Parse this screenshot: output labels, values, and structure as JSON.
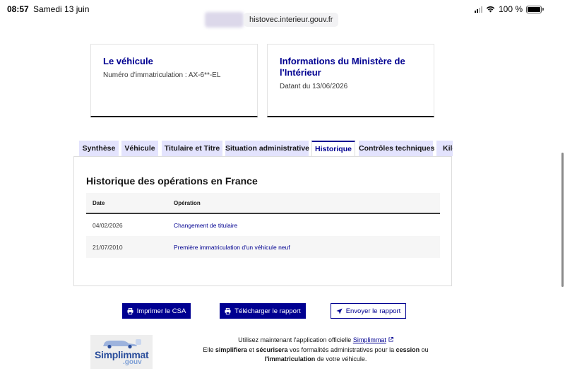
{
  "status": {
    "time": "08:57",
    "date": "Samedi 13 juin",
    "battery": "100 %"
  },
  "browser": {
    "url": "histovec.interieur.gouv.fr"
  },
  "cards": {
    "vehicle": {
      "title": "Le véhicule",
      "text": "Numéro d'immatriculation : AX-6**-EL"
    },
    "ministry": {
      "title": "Informations du Ministère de l'Intérieur",
      "text": "Datant du 13/06/2026"
    }
  },
  "tabs": [
    {
      "label": "Synthèse"
    },
    {
      "label": "Véhicule"
    },
    {
      "label": "Titulaire et Titre"
    },
    {
      "label": "Situation administrative"
    },
    {
      "label": "Historique"
    },
    {
      "label": "Contrôles techniques"
    },
    {
      "label": "Kilométrage"
    }
  ],
  "active_tab": "Historique",
  "history": {
    "title": "Historique des opérations en France",
    "columns": {
      "date": "Date",
      "operation": "Opération"
    },
    "rows": [
      {
        "date": "04/02/2026",
        "operation": "Changement de titulaire"
      },
      {
        "date": "21/07/2010",
        "operation": "Première immatriculation d'un véhicule neuf"
      }
    ]
  },
  "actions": {
    "print": "Imprimer le CSA",
    "download": "Télécharger le rapport",
    "send": "Envoyer le rapport"
  },
  "footer": {
    "logo_text": "Simplimmat",
    "logo_sub": ".gouv",
    "line1_before": "Utilisez maintenant l'application officielle",
    "link": "Simplimmat",
    "line2_a": "Elle",
    "line2_b": "simplifiera",
    "line2_c": "et",
    "line2_d": "sécurisera",
    "line2_e": "vos formalités administratives pour la",
    "line2_f": "cession",
    "line2_g": "ou",
    "line3_a": "l'immatriculation",
    "line3_b": "de votre véhicule."
  },
  "colors": {
    "primary": "#000091",
    "tab_bg": "#e3e3fd",
    "table_alt": "#f6f6f6"
  },
  "icons": [
    "wifi-icon",
    "battery-icon",
    "printer-icon",
    "send-icon",
    "external-link-icon"
  ]
}
